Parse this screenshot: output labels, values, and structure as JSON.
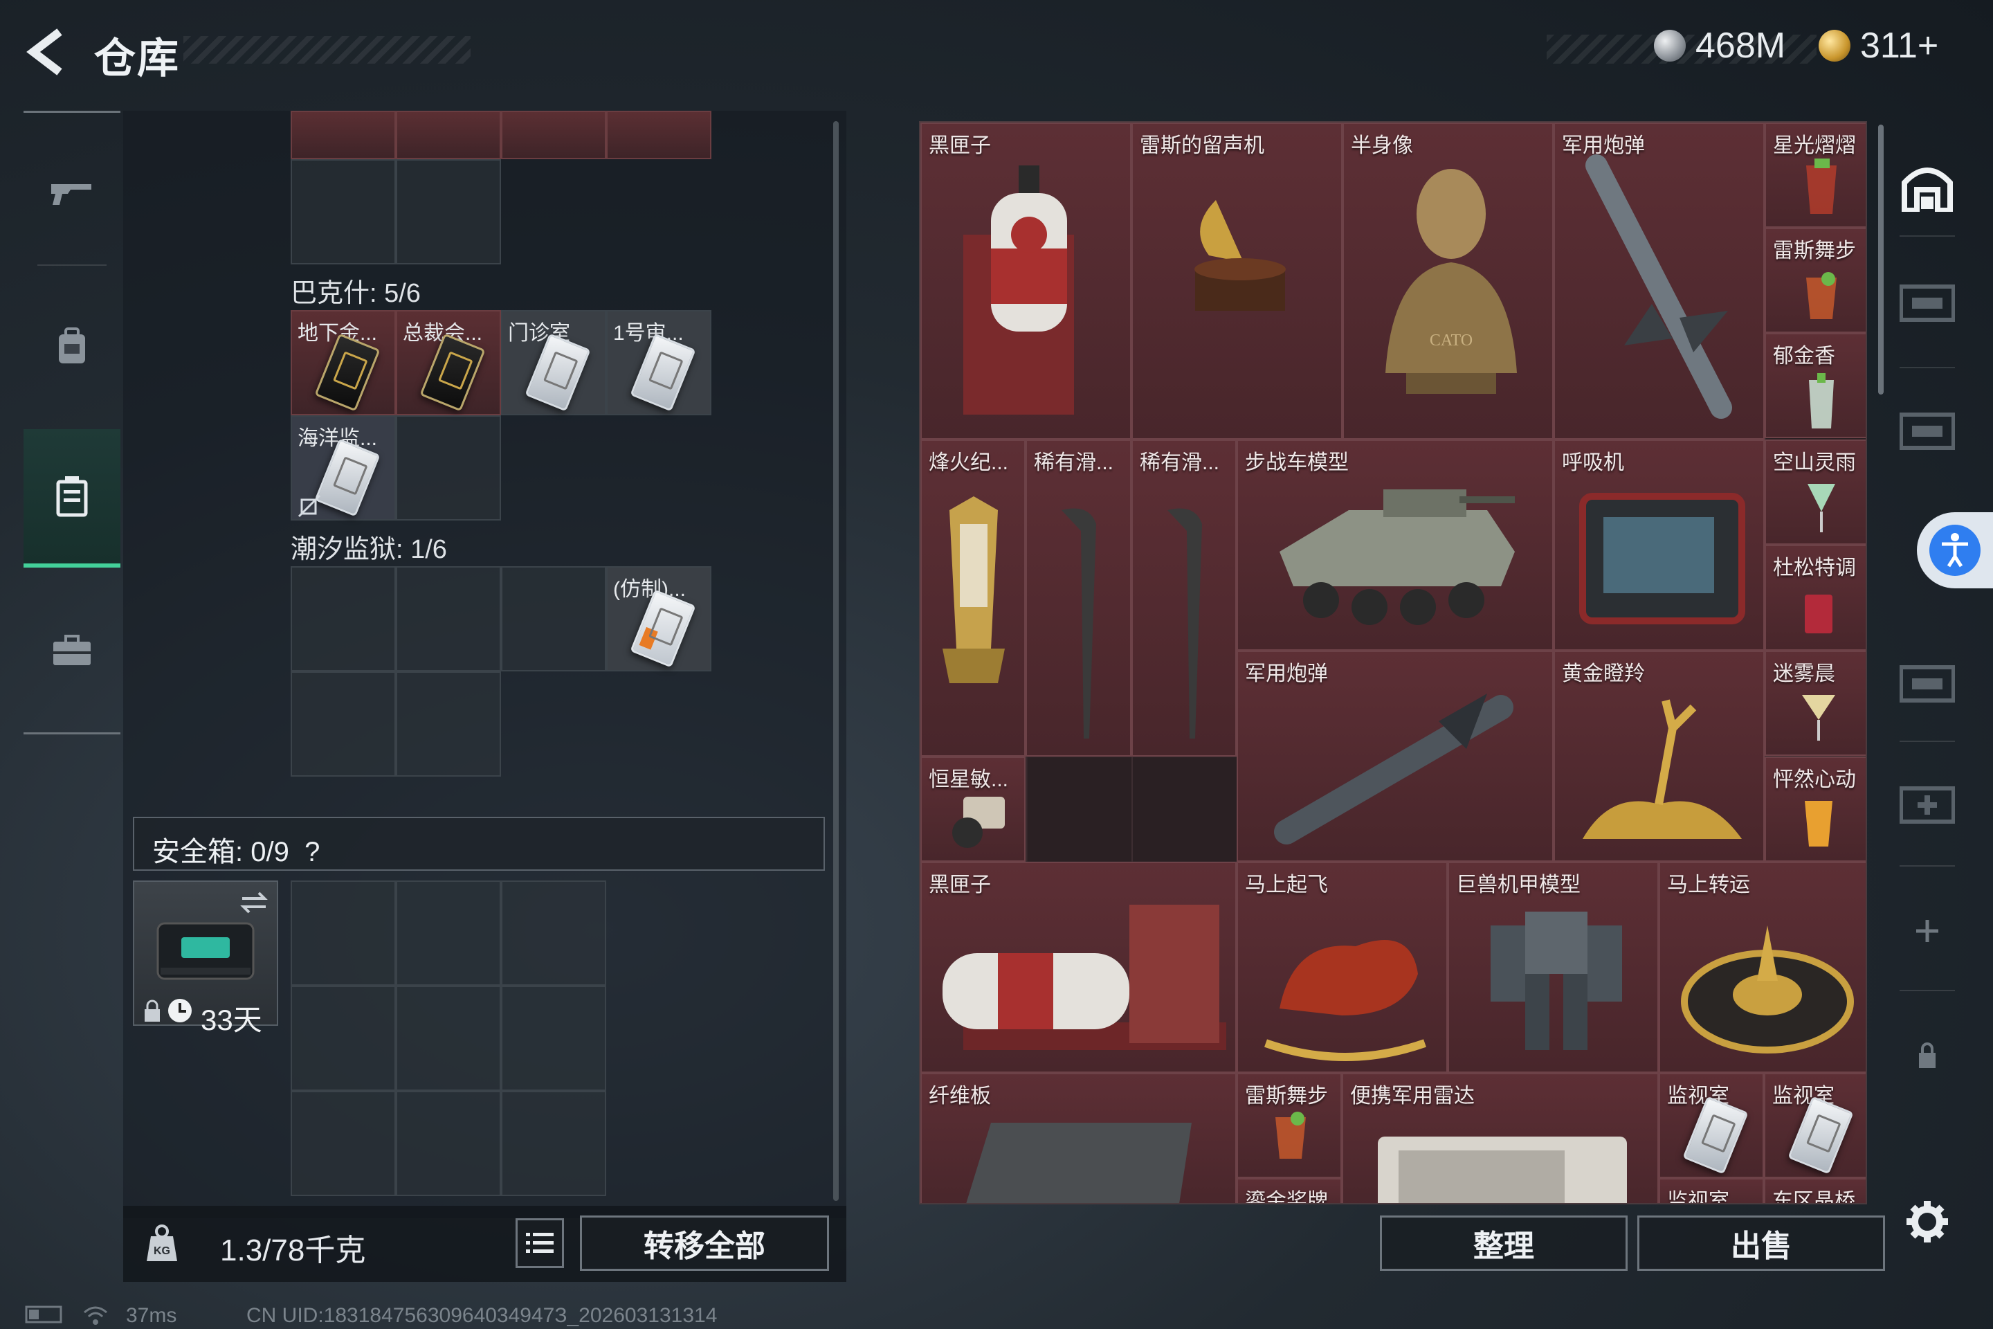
{
  "header": {
    "title": "仓库",
    "currency_silver": "468M",
    "currency_gold": "311+"
  },
  "sidebar": {
    "items": [
      {
        "icon": "gun-icon"
      },
      {
        "icon": "backpack-icon"
      },
      {
        "icon": "storage-box-icon",
        "active": true
      },
      {
        "icon": "briefcase-icon"
      }
    ]
  },
  "left": {
    "bakesh_title": "巴克什: 5/6",
    "bakesh_cards": [
      "地下金...",
      "总裁会...",
      "门诊室",
      "1号审...",
      "海洋监..."
    ],
    "prison_title": "潮汐监狱: 1/6",
    "prison_cards": [
      "(仿制)..."
    ],
    "safebox_label": "安全箱: 0/9",
    "safebox_help": "?",
    "safebox_days": "33天",
    "weight": "1.3/78千克",
    "transfer_all": "转移全部"
  },
  "right": {
    "items": [
      "黑匣子",
      "雷斯的留声机",
      "半身像",
      "军用炮弹",
      "星光熠熠",
      "雷斯舞步",
      "郁金香",
      "烽火纪...",
      "稀有滑...",
      "稀有滑...",
      "步战车模型",
      "呼吸机",
      "空山灵雨",
      "杜松特调",
      "军用炮弹",
      "黄金瞪羚",
      "迷雾晨",
      "恒星敏...",
      "怦然心动",
      "黑匣子",
      "马上起飞",
      "巨兽机甲模型",
      "马上转运",
      "纤维板",
      "雷斯舞步",
      "便携军用雷达",
      "监视室",
      "监视室",
      "鎏金奖牌",
      "监视室",
      "东区晶桥"
    ],
    "bust_plate": "CATO",
    "sort_button": "整理",
    "sell_button": "出售"
  },
  "footer": {
    "ping": "37ms",
    "uid": "CN UID:18318475630964034947З_202603131314"
  },
  "colors": {
    "accent": "#43d19a",
    "item_bg": "#5d2f35",
    "panel_bg": "#2a2023"
  }
}
